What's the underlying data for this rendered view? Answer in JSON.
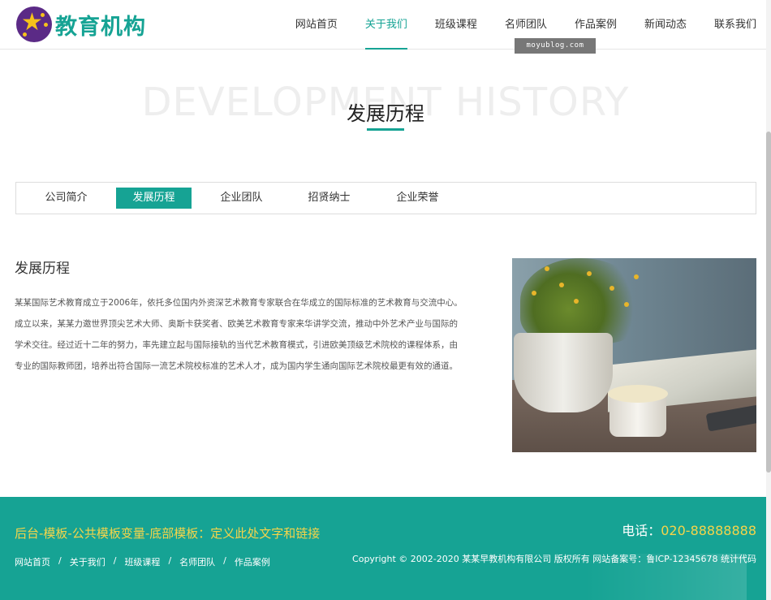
{
  "header": {
    "logo_text": "教育机构",
    "nav": [
      {
        "label": "网站首页"
      },
      {
        "label": "关于我们"
      },
      {
        "label": "班级课程"
      },
      {
        "label": "名师团队"
      },
      {
        "label": "作品案例"
      },
      {
        "label": "新闻动态"
      },
      {
        "label": "联系我们"
      }
    ],
    "active_nav": "关于我们",
    "watermark": "moyublog.com"
  },
  "title_section": {
    "background_text": "DEVELOPMENT HISTORY",
    "title": "发展历程"
  },
  "tabs": [
    {
      "label": "公司简介"
    },
    {
      "label": "发展历程"
    },
    {
      "label": "企业团队"
    },
    {
      "label": "招贤纳士"
    },
    {
      "label": "企业荣誉"
    }
  ],
  "active_tab": "发展历程",
  "content": {
    "heading": "发展历程",
    "paragraph": "某某国际艺术教育成立于2006年，依托多位国内外资深艺术教育专家联合在华成立的国际标准的艺术教育与交流中心。成立以来，某某力邀世界顶尖艺术大师、奥斯卡获奖者、欧美艺术教育专家来华讲学交流，推动中外艺术产业与国际的学术交往。经过近十二年的努力，率先建立起与国际接轨的当代艺术教育模式，引进欧美顶级艺术院校的课程体系，由专业的国际教师团，培养出符合国际一流艺术院校标准的艺术人才，成为国内学生通向国际艺术院校最更有效的通道。",
    "image_icon": "plant-photo"
  },
  "footer": {
    "slogan": "后台-模板-公共模板变量-底部模板：定义此处文字和链接",
    "links": [
      {
        "label": "网站首页"
      },
      {
        "label": "关于我们"
      },
      {
        "label": "班级课程"
      },
      {
        "label": "名师团队"
      },
      {
        "label": "作品案例"
      }
    ],
    "link_separator": "/",
    "phone_label": "电话：",
    "phone_number": "020-88888888",
    "copyright": "Copyright © 2002-2020 某某早教机构有限公司 版权所有  网站备案号：鲁ICP-12345678 统计代码"
  },
  "colors": {
    "accent": "#16a394",
    "highlight": "#f5d44a",
    "logo_circle": "#5b2a86"
  }
}
